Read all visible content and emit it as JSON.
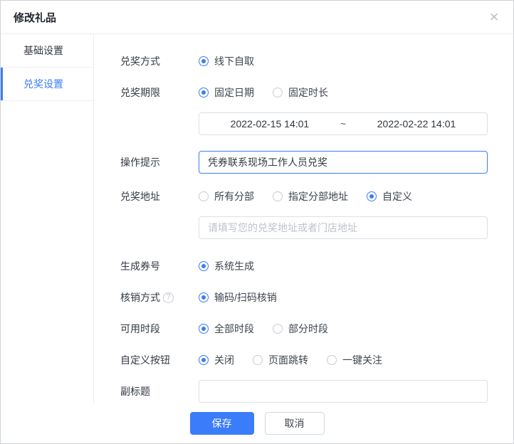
{
  "modal": {
    "title": "修改礼品",
    "close_glyph": "×"
  },
  "sidebar": {
    "items": [
      {
        "label": "基础设置",
        "active": false
      },
      {
        "label": "兑奖设置",
        "active": true
      }
    ]
  },
  "form": {
    "redeem_method": {
      "label": "兑奖方式",
      "options": [
        {
          "label": "线下自取",
          "selected": true
        }
      ]
    },
    "redeem_period": {
      "label": "兑奖期限",
      "options": [
        {
          "label": "固定日期",
          "selected": true
        },
        {
          "label": "固定时长",
          "selected": false
        }
      ],
      "start": "2022-02-15 14:01",
      "separator": "~",
      "end": "2022-02-22 14:01"
    },
    "operation_tip": {
      "label": "操作提示",
      "value": "凭券联系现场工作人员兑奖"
    },
    "redeem_address": {
      "label": "兑奖地址",
      "options": [
        {
          "label": "所有分部",
          "selected": false
        },
        {
          "label": "指定分部地址",
          "selected": false
        },
        {
          "label": "自定义",
          "selected": true
        }
      ],
      "placeholder": "请填写您的兑奖地址或者门店地址"
    },
    "coupon_number": {
      "label": "生成券号",
      "options": [
        {
          "label": "系统生成",
          "selected": true
        }
      ]
    },
    "verify_method": {
      "label": "核销方式",
      "help_glyph": "?",
      "options": [
        {
          "label": "输码/扫码核销",
          "selected": true
        }
      ]
    },
    "available_time": {
      "label": "可用时段",
      "options": [
        {
          "label": "全部时段",
          "selected": true
        },
        {
          "label": "部分时段",
          "selected": false
        }
      ]
    },
    "custom_button": {
      "label": "自定义按钮",
      "options": [
        {
          "label": "关闭",
          "selected": true
        },
        {
          "label": "页面跳转",
          "selected": false
        },
        {
          "label": "一键关注",
          "selected": false
        }
      ]
    },
    "subtitle": {
      "label": "副标题"
    }
  },
  "footer": {
    "save_label": "保存",
    "cancel_label": "取消"
  },
  "colors": {
    "accent": "#3b7cfa"
  }
}
